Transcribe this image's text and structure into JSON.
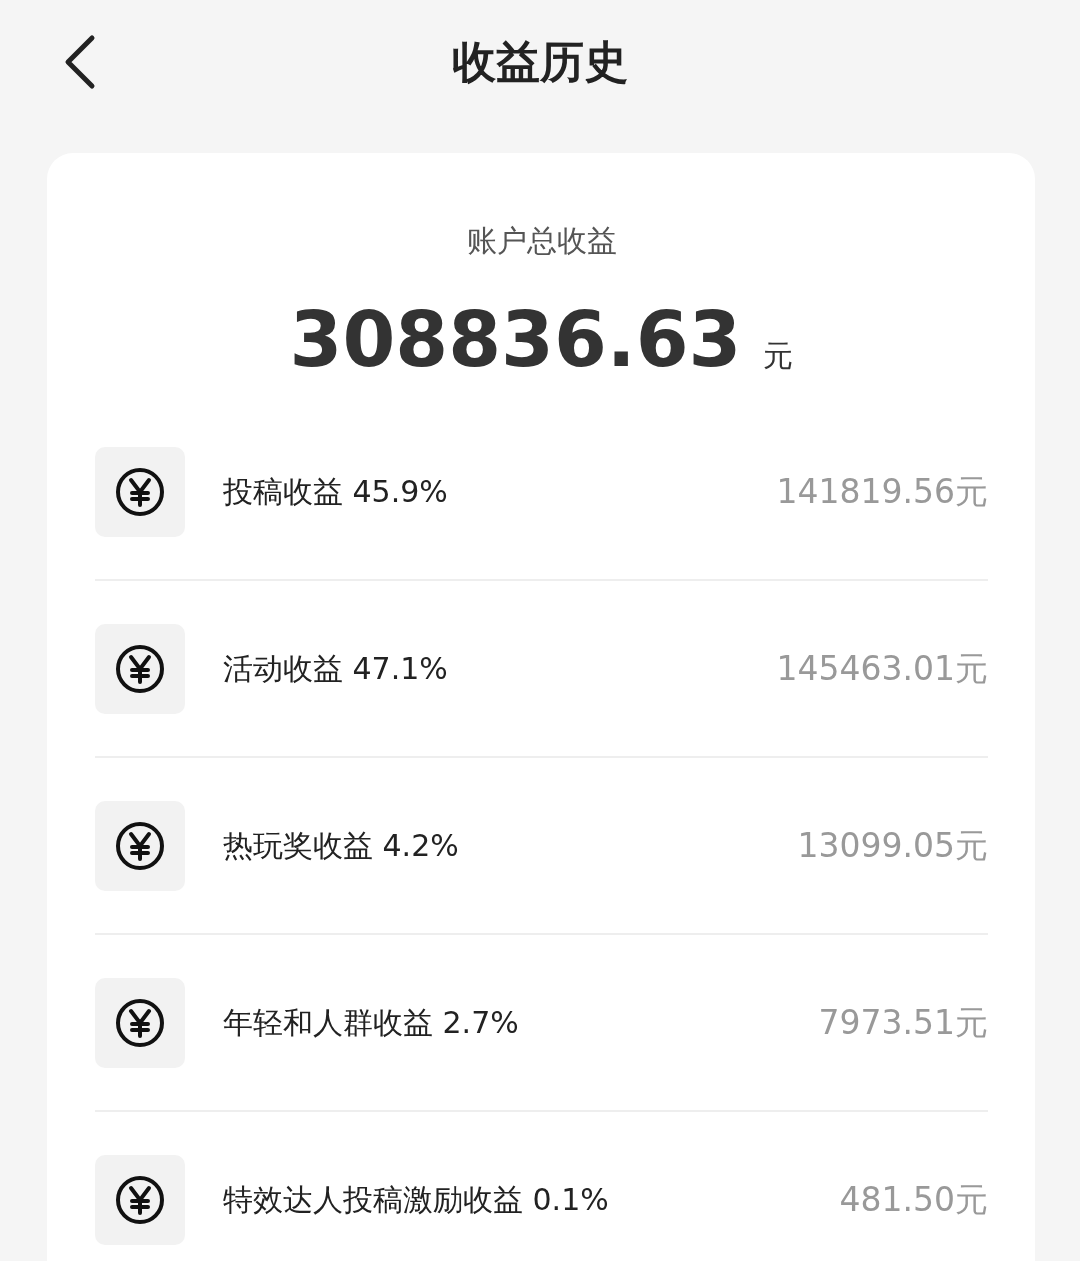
{
  "header": {
    "title": "收益历史"
  },
  "summary": {
    "label": "账户总收益",
    "total": "308836.63",
    "unit": "元"
  },
  "items": [
    {
      "label": "投稿收益 45.9%",
      "amount": "141819.56元"
    },
    {
      "label": "活动收益 47.1%",
      "amount": "145463.01元"
    },
    {
      "label": "热玩奖收益 4.2%",
      "amount": "13099.05元"
    },
    {
      "label": "年轻和人群收益 2.7%",
      "amount": "7973.51元"
    },
    {
      "label": "特效达人投稿激励收益 0.1%",
      "amount": "481.50元"
    }
  ]
}
